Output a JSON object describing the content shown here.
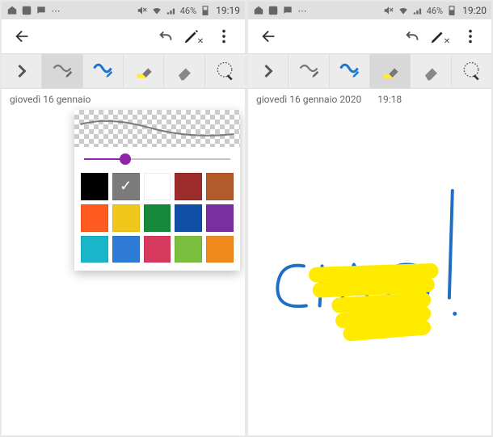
{
  "status": {
    "battery_pct": "46%",
    "left_time": "19:19",
    "right_time": "19:20"
  },
  "toolbar": {
    "expand_label": "Espandi",
    "pencil_label": "Matita",
    "pen_label": "Penna",
    "highlighter_label": "Evidenziatore",
    "eraser_label": "Gomma",
    "lasso_label": "Selezione"
  },
  "note": {
    "left_date": "giovedì 16 gennaio",
    "right_date": "giovedì 16 gennaio 2020",
    "right_time": "19:18",
    "handwriting_text": "CIAO!"
  },
  "brush_popup": {
    "slider_value_pct": 28,
    "selected_color_index": 1,
    "colors": [
      "#000000",
      "#7b7b7b",
      "#ffffff",
      "#9c2b2b",
      "#b15a2a",
      "#ff5a1f",
      "#f2c71b",
      "#168a3a",
      "#0f4fa8",
      "#7a2fa0",
      "#19b6c9",
      "#2e7bd6",
      "#d7395f",
      "#7bbf3f",
      "#f08a1d"
    ]
  }
}
